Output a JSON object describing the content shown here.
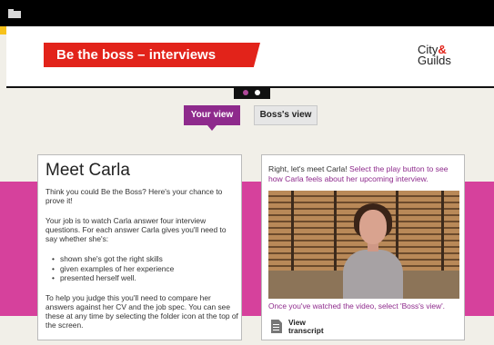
{
  "header": {
    "title": "Be the boss – interviews",
    "logo": {
      "line1": "City",
      "amp": "&",
      "line2": "Guilds"
    }
  },
  "icons": {
    "folder": "folder-icon",
    "transcript": "document-icon"
  },
  "pager": {
    "count": 2,
    "active_index": 0
  },
  "tabs": [
    {
      "label": "Your view",
      "active": true
    },
    {
      "label": "Boss's view",
      "active": false
    }
  ],
  "left_panel": {
    "title": "Meet Carla",
    "intro": "Think you could Be the Boss? Here's your chance to prove it!",
    "job": "Your job is to watch Carla answer four interview questions. For each answer Carla gives you'll need to say whether she's:",
    "bullets": [
      "shown she's got the right skills",
      "given examples of her experience",
      "presented herself well."
    ],
    "compare": "To help you judge this you'll need to compare her answers against her CV and the job spec. You can see these at any time by selecting the folder icon at the top of the screen."
  },
  "right_panel": {
    "intro_plain": "Right, let's meet Carla!",
    "intro_highlight": "Select the play button to see how Carla feels about her upcoming interview.",
    "outro": "Once you've watched the video, select 'Boss's view'.",
    "transcript_line1": "View",
    "transcript_line2": "transcript"
  },
  "colors": {
    "brand_red": "#e2231a",
    "accent_purple": "#8e2a8c",
    "magenta_band": "#d6419c",
    "top_bar": "#000000"
  }
}
